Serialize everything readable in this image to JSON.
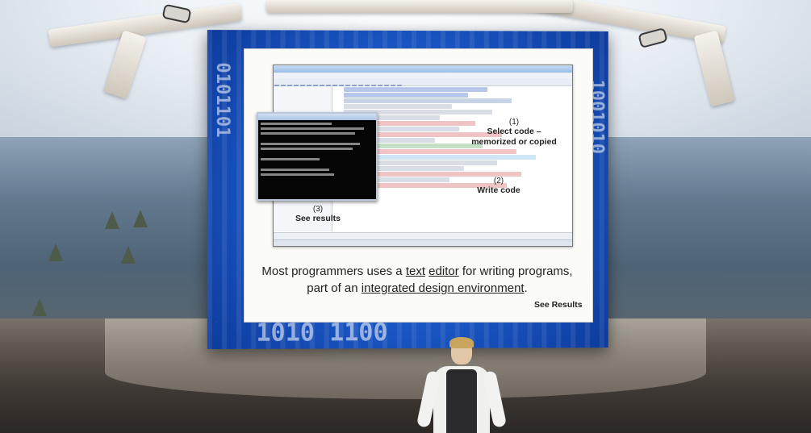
{
  "slide": {
    "annotations": [
      {
        "num": "(1)",
        "text": "Select code –\nmemorized or copied"
      },
      {
        "num": "(2)",
        "text": "Write code"
      },
      {
        "num": "(3)",
        "text": "See results"
      }
    ],
    "caption": {
      "part1": "Most programmers uses a ",
      "link1": "text",
      "space": " ",
      "link2": "editor",
      "part2": " for writing programs, part of an ",
      "link3": "integrated design environment",
      "part3": "."
    },
    "see_results": "See Results"
  },
  "colors": {
    "screen_blue": "#1b58c6",
    "slide_bg": "#fbfbf8"
  },
  "icons": [
    "spotlight-icon",
    "spotlight-icon"
  ]
}
